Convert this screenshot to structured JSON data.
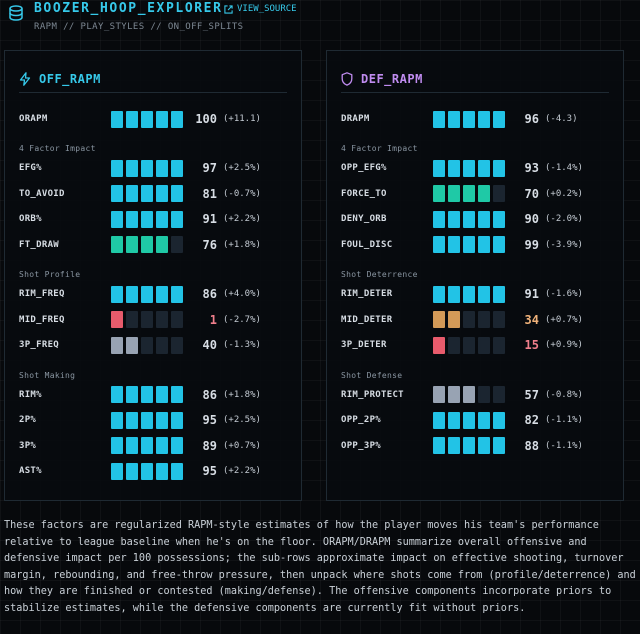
{
  "header": {
    "title": "BOOZER_HOOP_EXPLORER",
    "view_source": "VIEW_SOURCE",
    "breadcrumb": "RAPM // PLAY_STYLES // ON_OFF_SPLITS"
  },
  "colors": {
    "accent": "#36c9ea",
    "def_accent": "#c08cf0",
    "high": "#22c3e6",
    "good": "#1fc9a6",
    "mid": "#98a3b3",
    "warn": "#d39a58",
    "low": "#e85b6c",
    "empty": "#1b2530"
  },
  "off": {
    "title": "OFF_RAPM",
    "icon": "bolt-icon",
    "main": {
      "label": "ORAPM",
      "value": "100",
      "delta": "(+11.1)",
      "fill": 5,
      "color": "high"
    },
    "sections": [
      {
        "title": "4 Factor Impact",
        "rows": [
          {
            "label": "EFG%",
            "value": "97",
            "delta": "(+2.5%)",
            "fill": 5,
            "color": "high"
          },
          {
            "label": "TO_AVOID",
            "value": "81",
            "delta": "(-0.7%)",
            "fill": 5,
            "color": "high"
          },
          {
            "label": "ORB%",
            "value": "91",
            "delta": "(+2.2%)",
            "fill": 5,
            "color": "high"
          },
          {
            "label": "FT_DRAW",
            "value": "76",
            "delta": "(+1.8%)",
            "fill": 4,
            "color": "good"
          }
        ]
      },
      {
        "title": "Shot Profile",
        "rows": [
          {
            "label": "RIM_FREQ",
            "value": "86",
            "delta": "(+4.0%)",
            "fill": 5,
            "color": "high"
          },
          {
            "label": "MID_FREQ",
            "value": "1",
            "delta": "(-2.7%)",
            "fill": 1,
            "color": "low"
          },
          {
            "label": "3P_FREQ",
            "value": "40",
            "delta": "(-1.3%)",
            "fill": 2,
            "color": "mid"
          }
        ]
      },
      {
        "title": "Shot Making",
        "rows": [
          {
            "label": "RIM%",
            "value": "86",
            "delta": "(+1.8%)",
            "fill": 5,
            "color": "high"
          },
          {
            "label": "2P%",
            "value": "95",
            "delta": "(+2.5%)",
            "fill": 5,
            "color": "high"
          },
          {
            "label": "3P%",
            "value": "89",
            "delta": "(+0.7%)",
            "fill": 5,
            "color": "high"
          },
          {
            "label": "AST%",
            "value": "95",
            "delta": "(+2.2%)",
            "fill": 5,
            "color": "high"
          }
        ]
      }
    ]
  },
  "def": {
    "title": "DEF_RAPM",
    "icon": "shield-icon",
    "main": {
      "label": "DRAPM",
      "value": "96",
      "delta": "(-4.3)",
      "fill": 5,
      "color": "high"
    },
    "sections": [
      {
        "title": "4 Factor Impact",
        "rows": [
          {
            "label": "OPP_EFG%",
            "value": "93",
            "delta": "(-1.4%)",
            "fill": 5,
            "color": "high"
          },
          {
            "label": "FORCE_TO",
            "value": "70",
            "delta": "(+0.2%)",
            "fill": 4,
            "color": "good"
          },
          {
            "label": "DENY_ORB",
            "value": "90",
            "delta": "(-2.0%)",
            "fill": 5,
            "color": "high"
          },
          {
            "label": "FOUL_DISC",
            "value": "99",
            "delta": "(-3.9%)",
            "fill": 5,
            "color": "high"
          }
        ]
      },
      {
        "title": "Shot Deterrence",
        "rows": [
          {
            "label": "RIM_DETER",
            "value": "91",
            "delta": "(-1.6%)",
            "fill": 5,
            "color": "high"
          },
          {
            "label": "MID_DETER",
            "value": "34",
            "delta": "(+0.7%)",
            "fill": 2,
            "color": "warn"
          },
          {
            "label": "3P_DETER",
            "value": "15",
            "delta": "(+0.9%)",
            "fill": 1,
            "color": "low"
          }
        ]
      },
      {
        "title": "Shot Defense",
        "rows": [
          {
            "label": "RIM_PROTECT",
            "value": "57",
            "delta": "(-0.8%)",
            "fill": 3,
            "color": "mid"
          },
          {
            "label": "OPP_2P%",
            "value": "82",
            "delta": "(-1.1%)",
            "fill": 5,
            "color": "high"
          },
          {
            "label": "OPP_3P%",
            "value": "88",
            "delta": "(-1.1%)",
            "fill": 5,
            "color": "high"
          }
        ]
      }
    ]
  },
  "caption": "These factors are regularized RAPM-style estimates of how the player moves his team's performance relative to league baseline when he's on the floor. ORAPM/DRAPM summarize overall offensive and defensive impact per 100 possessions; the sub-rows approximate impact on effective shooting, turnover margin, rebounding, and free-throw pressure, then unpack where shots come from (profile/deterrence) and how they are finished or contested (making/defense). The offensive components incorporate priors to stabilize estimates, while the defensive components are currently fit without priors."
}
